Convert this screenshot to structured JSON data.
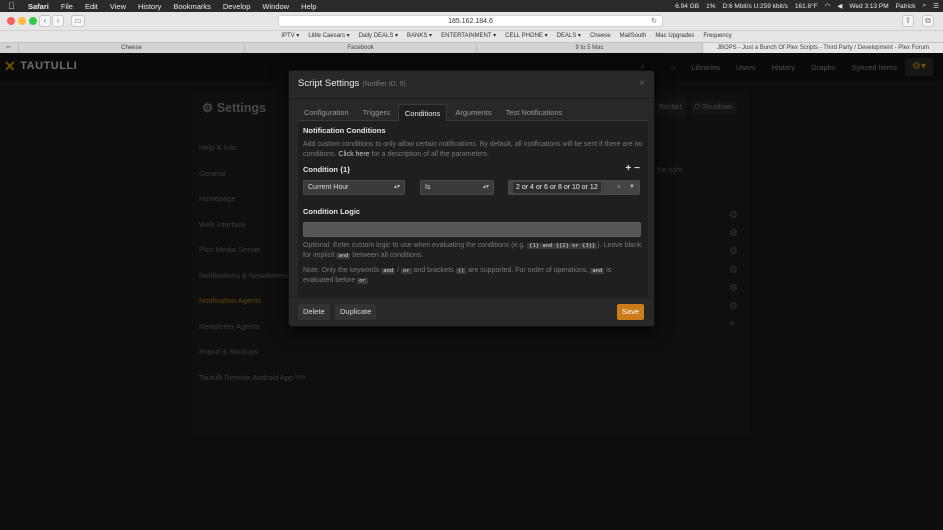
{
  "menubar": {
    "apple_glyph": "",
    "items": [
      "Safari",
      "File",
      "Edit",
      "View",
      "History",
      "Bookmarks",
      "Develop",
      "Window",
      "Help"
    ],
    "status": [
      "6.94 GB",
      "1%",
      "D:6 Mbit/s U:259 kbit/s",
      "161.6°F",
      "Wed 3:13 PM",
      "Patrick"
    ]
  },
  "browser": {
    "url": "185.162.184.6",
    "bookmarks": [
      "IPTV ▾",
      "Little Caesars ▾",
      "Daily DEALS ▾",
      "BANKS ▾",
      "ENTERTAINMENT ▾",
      "CELL PHONE ▾",
      "DEALS ▾",
      "Cheese",
      "MailSouth",
      "Mac Upgrades",
      "Frequency"
    ],
    "tabs": [
      "Cheese",
      "Facebook",
      "9 to 5 Mac",
      "JBOPS - Just a Bunch Of Plex Scripts - Third Party / Development - Plex Forum"
    ]
  },
  "app": {
    "brand": "TAUTULLI",
    "nav": [
      "Libraries",
      "Users",
      "History",
      "Graphs",
      "Synced Items"
    ],
    "settings_title": "Settings",
    "sidebar": [
      "Help & Info",
      "General",
      "Homepage",
      "Web Interface",
      "Plex Media Server",
      "Notifications & Newsletters",
      "Notification Agents",
      "Newsletter Agents",
      "Import & Backups",
      "Tautulli Remote Android App ᵇᵉᵗᵃ"
    ],
    "active_sidebar": "Notification Agents",
    "restart_label": "Restart",
    "shutdown_label": "Shutdown",
    "behind_text": "n the right."
  },
  "modal": {
    "title": "Script Settings",
    "subtitle": "(Notifier ID: 9)",
    "tabs": [
      "Configuration",
      "Triggers",
      "Conditions",
      "Arguments",
      "Test Notifications"
    ],
    "active_tab": "Conditions",
    "section_title": "Notification Conditions",
    "help_pre": "Add custom conditions to only ",
    "help_it": "allow certain notifications",
    "help_post": ". By default, all notifications will be sent if there are no conditions. ",
    "help_link": "Click here",
    "help_end": " for a description of all the parameters.",
    "condition_label": "Condition {1}",
    "condition": {
      "parameter": "Current Hour",
      "operator": "Is",
      "value": "2 or 4 or 6 or 8 or 10 or 12"
    },
    "logic_title": "Condition Logic",
    "logic_value": "",
    "logic_help_a": "Optional: Enter custom logic to use when evaluating the conditions (e.g. ",
    "logic_code1": "{1} and {{2} or {3}}",
    "logic_help_b": "). Leave blank for implicit ",
    "logic_code2": "and",
    "logic_help_c": " between all conditions.",
    "note_a": "Note: Only the keywords ",
    "kw_and": "and",
    "kw_slash": " / ",
    "kw_or": "or",
    "note_b": " and brackets ",
    "kw_brackets": "()",
    "note_c": " are supported. For order of operations, ",
    "kw_and2": "and",
    "note_d": " is evaluated before ",
    "kw_or2": "or",
    "delete_label": "Delete",
    "duplicate_label": "Duplicate",
    "save_label": "Save"
  }
}
